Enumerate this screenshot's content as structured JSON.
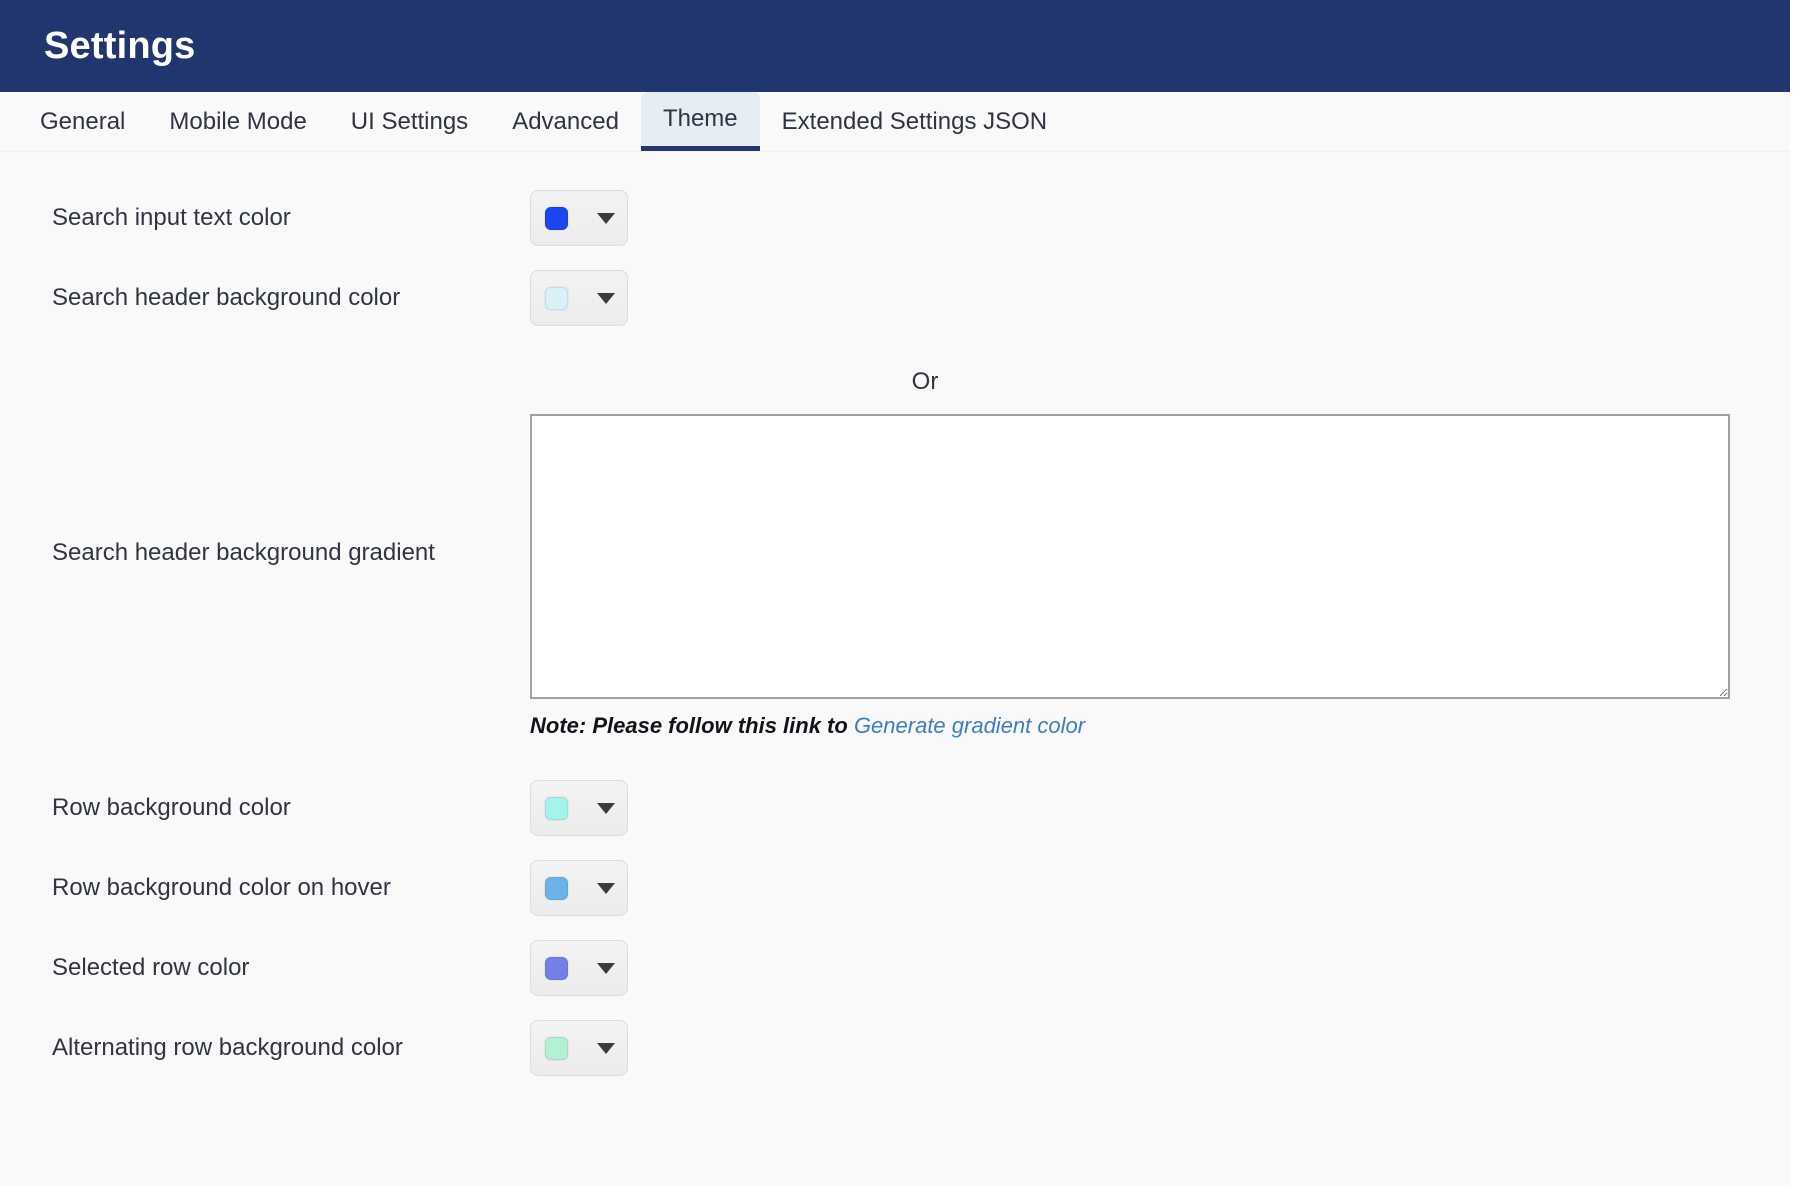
{
  "header": {
    "title": "Settings"
  },
  "tabs": [
    {
      "label": "General",
      "active": false
    },
    {
      "label": "Mobile Mode",
      "active": false
    },
    {
      "label": "UI Settings",
      "active": false
    },
    {
      "label": "Advanced",
      "active": false
    },
    {
      "label": "Theme",
      "active": true
    },
    {
      "label": "Extended Settings JSON",
      "active": false
    }
  ],
  "form": {
    "search_input_text_color": {
      "label": "Search input text color",
      "swatch_color": "#1a46f0"
    },
    "search_header_background_color": {
      "label": "Search header background color",
      "swatch_color": "#daf0f8"
    },
    "search_header_background_gradient": {
      "label": "Search header background gradient",
      "or_label": "Or",
      "textarea_value": "",
      "textarea_placeholder": "",
      "note_text": "Note: Please follow this link to ",
      "note_link_text": "Generate gradient color"
    },
    "row_background_color": {
      "label": "Row background color",
      "swatch_color": "#a5f3ed"
    },
    "row_background_color_on_hover": {
      "label": "Row background color on hover",
      "swatch_color": "#6cb3e8"
    },
    "selected_row_color": {
      "label": "Selected row color",
      "swatch_color": "#7480e8"
    },
    "alternating_row_background_color": {
      "label": "Alternating row background color",
      "swatch_color": "#b3f0d4"
    }
  },
  "colors": {
    "header_background": "#21356e",
    "active_tab_background": "#e5edf5",
    "active_tab_underline": "#21356e",
    "page_background": "#f9f9fa",
    "link": "#3d7ebf"
  },
  "icons": {
    "caret": "chevron-down-icon"
  }
}
